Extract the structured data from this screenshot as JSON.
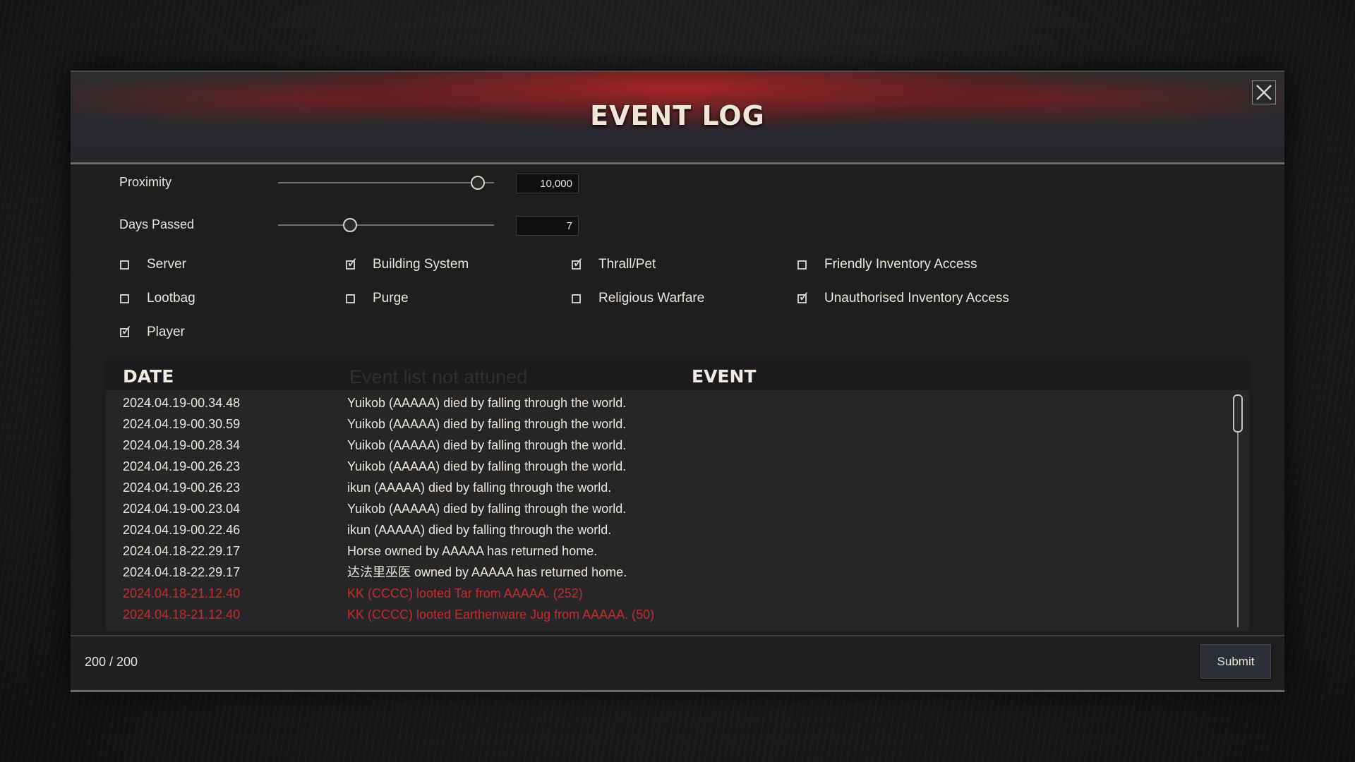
{
  "window": {
    "title": "EVENT LOG",
    "close_icon": "close-x-icon"
  },
  "filters": {
    "proximity": {
      "label": "Proximity",
      "value": "10,000",
      "slider_fraction": 0.92
    },
    "days_passed": {
      "label": "Days Passed",
      "value": "7",
      "slider_fraction": 0.33
    }
  },
  "checkboxes": [
    {
      "label": "Server",
      "checked": false
    },
    {
      "label": "Building System",
      "checked": true
    },
    {
      "label": "Thrall/Pet",
      "checked": true
    },
    {
      "label": "Friendly Inventory Access",
      "checked": false
    },
    {
      "label": "Lootbag",
      "checked": false
    },
    {
      "label": "Purge",
      "checked": false
    },
    {
      "label": "Religious Warfare",
      "checked": false
    },
    {
      "label": "Unauthorised Inventory Access",
      "checked": true
    },
    {
      "label": "Player",
      "checked": true
    }
  ],
  "table": {
    "date_header": "DATE",
    "event_header": "EVENT",
    "ghost_header": "Event list not attuned",
    "rows": [
      {
        "date": "2024.04.19-00.34.48",
        "event": "Yuikob (AAAAA) died by falling through the world.",
        "highlight": false
      },
      {
        "date": "2024.04.19-00.30.59",
        "event": "Yuikob (AAAAA) died by falling through the world.",
        "highlight": false
      },
      {
        "date": "2024.04.19-00.28.34",
        "event": "Yuikob (AAAAA) died by falling through the world.",
        "highlight": false
      },
      {
        "date": "2024.04.19-00.26.23",
        "event": "Yuikob (AAAAA) died by falling through the world.",
        "highlight": false
      },
      {
        "date": "2024.04.19-00.26.23",
        "event": "ikun (AAAAA) died by falling through the world.",
        "highlight": false
      },
      {
        "date": "2024.04.19-00.23.04",
        "event": "Yuikob (AAAAA) died by falling through the world.",
        "highlight": false
      },
      {
        "date": "2024.04.19-00.22.46",
        "event": "ikun (AAAAA) died by falling through the world.",
        "highlight": false
      },
      {
        "date": "2024.04.18-22.29.17",
        "event": "Horse owned by AAAAA has returned home.",
        "highlight": false
      },
      {
        "date": "2024.04.18-22.29.17",
        "event": "达法里巫医 owned by AAAAA has returned home.",
        "highlight": false
      },
      {
        "date": "2024.04.18-21.12.40",
        "event": "KK (CCCC) looted Tar from AAAAA. (252)",
        "highlight": true
      },
      {
        "date": "2024.04.18-21.12.40",
        "event": "KK (CCCC) looted Earthenware Jug from AAAAA. (50)",
        "highlight": true
      }
    ]
  },
  "footer": {
    "count": "200 / 200",
    "submit_label": "Submit"
  },
  "colors": {
    "normal_text": "#ebe6dc",
    "highlight_text": "#c42a2a",
    "header_red": "#b52222"
  }
}
